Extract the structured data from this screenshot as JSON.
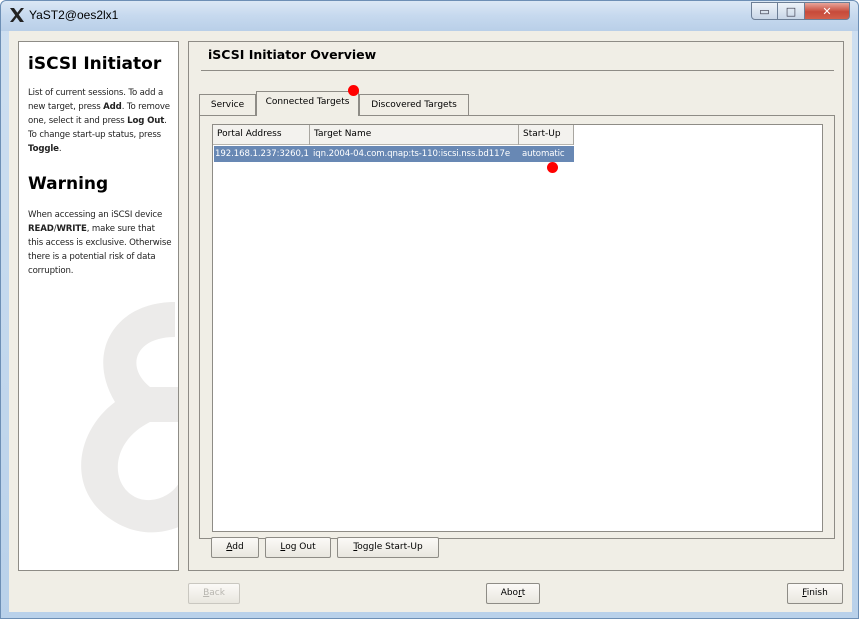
{
  "window": {
    "title": "YaST2@oes2lx1",
    "controls": {
      "minimize": "▭",
      "maximize": "□",
      "close": "✕"
    }
  },
  "help": {
    "heading": "iSCSI Initiator",
    "intro_parts": [
      "List of current sessions. To add a new target, press ",
      "Add",
      ". To remove one, select it and press ",
      "Log Out",
      ". To change start-up status, press ",
      "Toggle",
      "."
    ],
    "warning_heading": "Warning",
    "warning_parts": [
      "When accessing an iSCSI device ",
      "READ",
      "/",
      "WRITE",
      ", make sure that this access is exclusive. Otherwise there is a potential risk of data corruption."
    ]
  },
  "main": {
    "title": "iSCSI Initiator Overview",
    "tabs": [
      {
        "label": "Service",
        "active": false
      },
      {
        "label": "Connected Targets",
        "active": true
      },
      {
        "label": "Discovered Targets",
        "active": false
      }
    ],
    "table": {
      "columns": [
        "Portal Address",
        "Target Name",
        "Start-Up"
      ],
      "rows": [
        {
          "portal": "192.168.1.237:3260,1",
          "target": "iqn.2004-04.com.qnap:ts-110:iscsi.nss.bd117e",
          "startup": "automatic",
          "selected": true
        }
      ]
    },
    "buttons": {
      "add": {
        "mnemonic": "A",
        "rest": "dd"
      },
      "logout": {
        "mnemonic": "L",
        "rest": "og Out"
      },
      "toggle": {
        "mnemonic": "T",
        "rest": "oggle Start-Up"
      }
    }
  },
  "footer": {
    "back": {
      "mnemonic": "B",
      "rest": "ack",
      "enabled": false
    },
    "abort": {
      "pre": "Abo",
      "mnemonic": "r",
      "rest": "t"
    },
    "finish": {
      "mnemonic": "F",
      "rest": "inish"
    }
  },
  "colors": {
    "selection": "#6888b4",
    "marker": "#ff0000",
    "panel_background": "#f0eee6"
  }
}
